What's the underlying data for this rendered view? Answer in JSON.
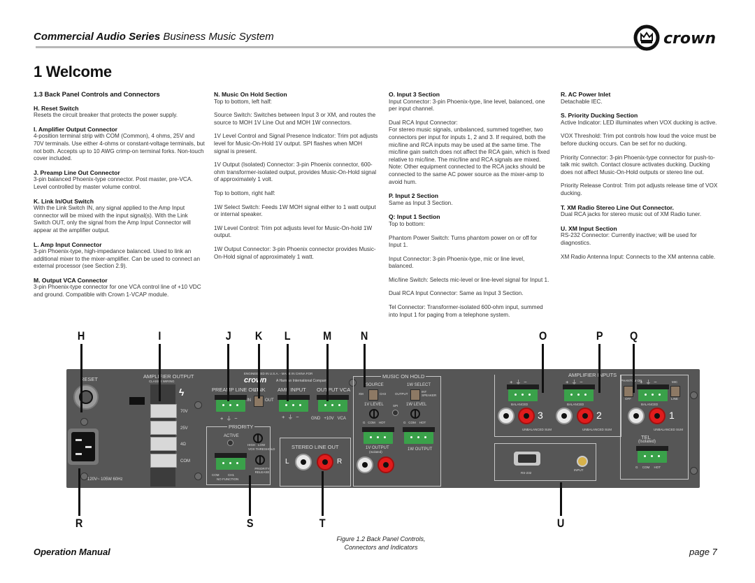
{
  "header": {
    "series_bold": "Commercial Audio Series",
    "series_rest": " Business Music System",
    "brand": "crown"
  },
  "page_title": "1 Welcome",
  "columns": {
    "col1": {
      "section_heading": "1.3 Back Panel Controls and Connectors",
      "items": [
        {
          "heading": "H. Reset Switch",
          "paragraphs": [
            "Resets the circuit breaker that protects the power supply."
          ]
        },
        {
          "heading": "I. Amplifier Output Connector",
          "paragraphs": [
            "4-position terminal strip with COM (Common), 4 ohms, 25V and 70V terminals. Use either 4-ohms or constant-voltage terminals, but not both. Accepts up to 10 AWG crimp-on terminal forks. Non-touch cover included."
          ]
        },
        {
          "heading": "J. Preamp Line Out Connector",
          "paragraphs": [
            "3-pin balanced Phoenix-type connector. Post master, pre-VCA. Level controlled by master volume control."
          ]
        },
        {
          "heading": "K. Link In/Out Switch",
          "paragraphs": [
            "With the Link Switch IN, any signal applied to the Amp Input connector will be mixed with the input signal(s). With the Link Switch OUT, only the signal from the Amp Input Connector will appear at the amplifier output."
          ]
        },
        {
          "heading": "L. Amp Input Connector",
          "paragraphs": [
            "3-pin Phoenix-type, high-impedance balanced. Used to link an additional mixer to the mixer-amplifier. Can be used to connect an external processor (see Section 2.9)."
          ]
        },
        {
          "heading": "M. Output VCA Connector",
          "paragraphs": [
            "3-pin Phoenix-type connector for one VCA control line of +10 VDC and ground. Compatible with Crown 1-VCAP module."
          ]
        }
      ]
    },
    "col2": {
      "items": [
        {
          "heading": "N. Music On Hold Section",
          "paragraphs": [
            "Top to bottom, left half:",
            "Source Switch: Switches between Input 3 or XM, and routes the source to MOH 1V Line Out and MOH 1W connectors.",
            "1V Level Control and Signal Presence Indicator: Trim pot adjusts level for Music-On-Hold 1V output. SPI flashes when MOH signal is present.",
            "1V Output (Isolated) Connector: 3-pin Phoenix connector, 600-ohm transformer-isolated output, provides Music-On-Hold signal of approximately 1 volt.",
            "Top to bottom, right half:",
            "1W Select Switch: Feeds 1W MOH signal either to 1 watt output or internal speaker.",
            "1W Level Control: Trim pot adjusts level for Music-On-hold 1W output.",
            "1W Output Connector: 3-pin Phoenix connector provides Music-On-Hold signal of approximately 1 watt."
          ]
        }
      ]
    },
    "col3": {
      "items": [
        {
          "heading": "O. Input 3 Section",
          "paragraphs": [
            "Input Connector: 3-pin Phoenix-type, line level, balanced, one per input channel.",
            "Dual RCA Input Connector:\nFor stereo music signals, unbalanced, summed together, two connectors per input for inputs 1, 2 and 3. If required, both the mic/line and RCA inputs may be used at the same time. The mic/line gain switch does not affect the RCA gain, which is fixed relative to mic/line. The mic/line and RCA signals are mixed. Note: Other equipment connected to the RCA jacks should be connected to the same AC power source as the mixer-amp to avoid hum."
          ]
        },
        {
          "heading": "P. Input 2 Section",
          "paragraphs": [
            "Same as Input 3 Section."
          ]
        },
        {
          "heading": "Q: Input 1 Section",
          "paragraphs": [
            "Top to bottom:",
            "Phantom Power Switch: Turns phantom power on or off for Input 1.",
            "Input Connector: 3-pin Phoenix-type, mic or line level, balanced.",
            "Mic/line Switch: Selects mic-level or line-level signal for Input 1.",
            "Dual RCA Input Connector: Same as Input 3 Section.",
            "Tel Connector: Transformer-isolated 600-ohm input, summed into Input 1 for paging from a telephone system."
          ]
        }
      ]
    },
    "col4": {
      "items": [
        {
          "heading": "R. AC Power Inlet",
          "paragraphs": [
            "Detachable IEC."
          ]
        },
        {
          "heading": "S. Priority Ducking Section",
          "paragraphs": [
            "Active Indicator: LED illuminates when VOX ducking is active.",
            "VOX Threshold: Trim pot controls how loud the voice must be before ducking occurs. Can be set for no ducking.",
            "Priority Connector: 3-pin Phoenix-type connector for push-to-talk mic switch. Contact closure activates ducking. Ducking does not affect Music-On-Hold outputs or stereo line out.",
            "Priority Release Control: Trim pot adjusts release time of VOX ducking."
          ]
        },
        {
          "heading": "T. XM Radio Stereo Line Out Connector.",
          "paragraphs": [
            "Dual RCA jacks for stereo music out of XM Radio tuner."
          ]
        },
        {
          "heading": "U. XM Input Section",
          "paragraphs": [
            "RS-232 Connector: Currently inactive; will be used for diagnostics.",
            "XM Radio Antenna Input: Connects to the XM antenna cable."
          ]
        }
      ]
    }
  },
  "figure": {
    "top_letters": [
      "H",
      "I",
      "J",
      "K",
      "L",
      "M",
      "N",
      "O",
      "P",
      "Q"
    ],
    "bottom_letters": [
      "R",
      "S",
      "T",
      "U"
    ],
    "panel": {
      "reset": "RESET",
      "amp_output": "AMPLIFIER OUTPUT",
      "class_wiring": "CLASS 2 WIRING",
      "terminals": [
        "70V",
        "25V",
        "4Ω",
        "COM"
      ],
      "power_rating": "120V~ 105W 60Hz",
      "engineered": "ENGINEERED IN U.S.A. - MADE IN CHINA FOR",
      "brand": "crown",
      "harman": "A Harman International Company",
      "preamp_line_out": "PREAMP LINE OUT",
      "link": "LINK",
      "link_in": "IN",
      "link_out": "OUT",
      "amp_input": "AMP INPUT",
      "output_vca": "OUTPUT VCA",
      "polarity": [
        "+",
        "⏚",
        "−"
      ],
      "vca_pins": [
        "GND",
        "+10V",
        "VCA"
      ],
      "priority": "PRIORITY",
      "active": "ACTIVE",
      "vox_high": "HIGH",
      "vox_low": "LOW",
      "vox_threshold": "VOX THRESHOLD",
      "priority_release": "PRIORITY RELEASE",
      "priority_pins": [
        "COM",
        "CH1"
      ],
      "no_function": "NO FUNCTION",
      "stereo_line_out": "STEREO LINE OUT",
      "left": "L",
      "right": "R",
      "music_on_hold": "MUSIC ON HOLD",
      "source": "SOURCE",
      "source_xm": "XM",
      "source_ch3": "CH3",
      "select_1w": "1W SELECT",
      "select_output": "OUTPUT",
      "select_int": "INT SPEAKER",
      "level_1v": "1V LEVEL",
      "spi": "SPI",
      "level_1w": "1W LEVEL",
      "moh_pins": [
        "G",
        "COM",
        "HOT"
      ],
      "output_1v": "1V OUTPUT",
      "isolated": "(Isolated)",
      "output_1w": "1W OUTPUT",
      "amplifier_inputs": "AMPLIFIER INPUTS",
      "balanced": "BALANCED",
      "unbalanced_sum": "UNBALANCED SUM",
      "input_numbers": [
        "3",
        "2",
        "1"
      ],
      "phantom_on": "PHANTOM ON",
      "phantom_off": "OFF",
      "mic": "MIC",
      "line": "LINE",
      "tel": "TEL",
      "tel_isolated": "(Isolated)",
      "tel_pins": [
        "G",
        "COM",
        "HOT"
      ],
      "rs232": "RS-232",
      "input": "INPUT"
    },
    "caption_line1": "Figure 1.2  Back Panel Controls,",
    "caption_line2": "Connectors and Indicators"
  },
  "footer": {
    "left": "Operation Manual",
    "right": "page 7"
  }
}
